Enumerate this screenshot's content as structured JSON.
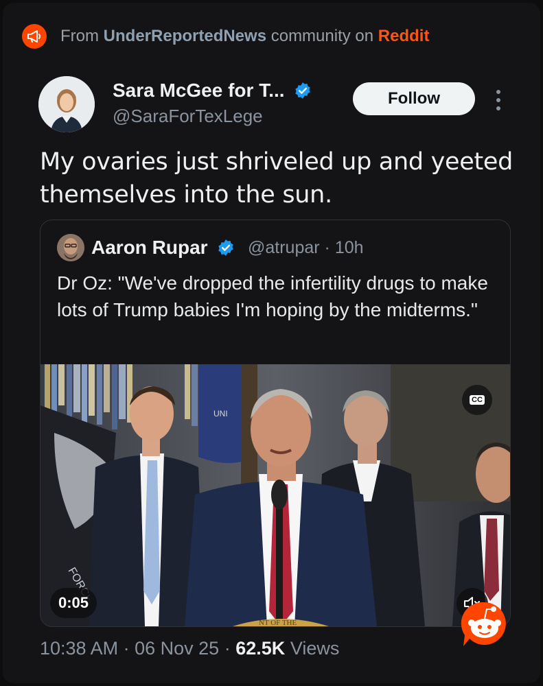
{
  "source": {
    "prefix": "From",
    "community": "UnderReportedNews",
    "middle": "community on",
    "platform": "Reddit",
    "icon": "megaphone-icon"
  },
  "tweet": {
    "author_name": "Sara McGee for T...",
    "author_handle": "@SaraForTexLege",
    "verified": true,
    "follow_label": "Follow",
    "text": "My ovaries just shriveled up and yeeted themselves into the sun."
  },
  "quoted_tweet": {
    "author_name": "Aaron Rupar",
    "author_handle": "@atrupar",
    "separator": "·",
    "time": "10h",
    "verified": true,
    "text": "Dr Oz: \"We've dropped the infertility drugs to make lots of Trump babies I'm hoping by the midterms.\"",
    "video": {
      "duration": "0:05",
      "cc_label": "CC",
      "muted": true,
      "podium_text": "NT OF THE",
      "flag_text": "UNI",
      "wall_text": "FORCE"
    }
  },
  "footer": {
    "time": "10:38 AM",
    "sep1": "·",
    "date": "06 Nov 25",
    "sep2": "·",
    "views_count": "62.5K",
    "views_label": "Views"
  },
  "colors": {
    "background": "#141416",
    "reddit_orange": "#ff4500",
    "verified_blue": "#1d9bf0",
    "muted_text": "#8b949e"
  }
}
